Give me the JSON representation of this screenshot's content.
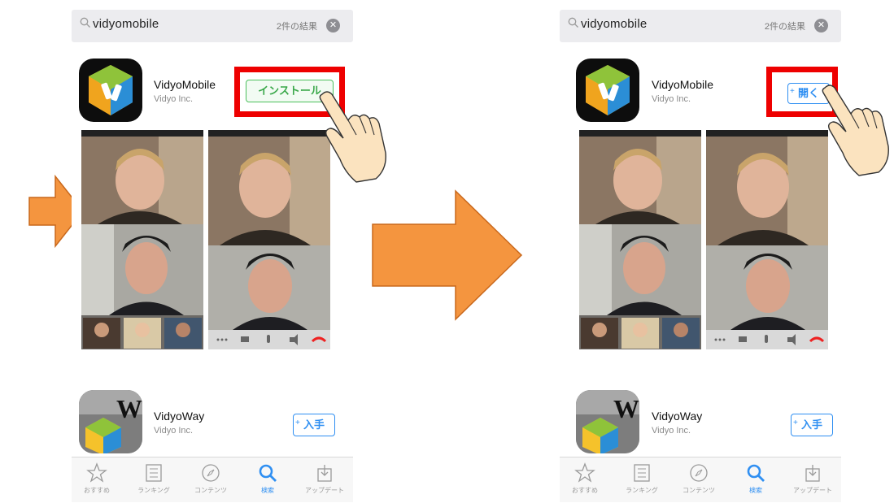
{
  "left": {
    "search": {
      "query": "vidyomobile",
      "result_count": "2件の結果"
    },
    "primary_app": {
      "name": "VidyoMobile",
      "developer": "Vidyo Inc.",
      "action_label": "インストール"
    },
    "secondary_app": {
      "name": "VidyoWay",
      "developer": "Vidyo Inc.",
      "action_label": "入手"
    }
  },
  "right": {
    "search": {
      "query": "vidyomobile",
      "result_count": "2件の結果"
    },
    "primary_app": {
      "name": "VidyoMobile",
      "developer": "Vidyo Inc.",
      "action_label": "開く"
    },
    "secondary_app": {
      "name": "VidyoWay",
      "developer": "Vidyo Inc.",
      "action_label": "入手"
    }
  },
  "tabs": [
    {
      "label": "おすすめ",
      "icon": "star-icon"
    },
    {
      "label": "ランキング",
      "icon": "list-icon"
    },
    {
      "label": "コンテンツ",
      "icon": "compass-icon"
    },
    {
      "label": "検索",
      "icon": "search-icon",
      "active": true
    },
    {
      "label": "アップデート",
      "icon": "download-icon"
    }
  ],
  "colors": {
    "accent": "#2f8ff2",
    "highlight": "#ee0000",
    "arrow": "#f4953f"
  }
}
